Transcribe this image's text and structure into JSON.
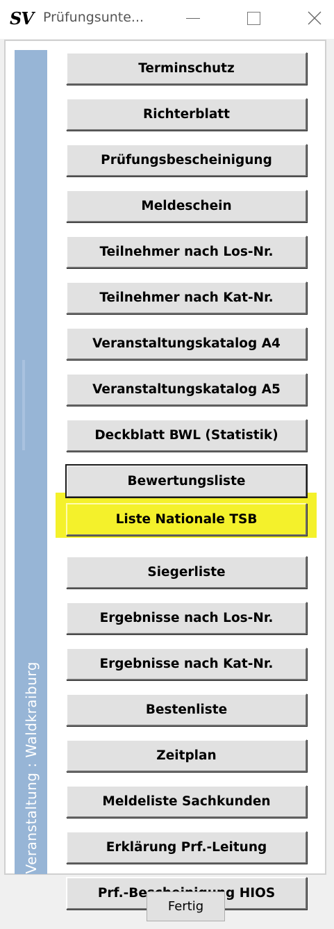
{
  "window": {
    "app_icon_text": "SV",
    "title": "Prüfungsunte..."
  },
  "sidebar": {
    "label": "Veranstaltung : Waldkraiburg",
    "color": "#97b5d6"
  },
  "buttons": [
    {
      "label": "Terminschutz"
    },
    {
      "label": "Richterblatt"
    },
    {
      "label": "Prüfungsbescheinigung"
    },
    {
      "label": "Meldeschein"
    },
    {
      "label": "Teilnehmer nach Los-Nr."
    },
    {
      "label": "Teilnehmer nach Kat-Nr."
    },
    {
      "label": "Veranstaltungskatalog A4"
    },
    {
      "label": "Veranstaltungskatalog A5"
    },
    {
      "label": "Deckblatt BWL (Statistik)"
    },
    {
      "label": "Bewertungsliste"
    },
    {
      "label": "Liste Nationale TSB"
    },
    {
      "label": "Siegerliste"
    },
    {
      "label": "Ergebnisse nach Los-Nr."
    },
    {
      "label": "Ergebnisse nach Kat-Nr."
    },
    {
      "label": "Bestenliste"
    },
    {
      "label": "Zeitplan"
    },
    {
      "label": "Meldeliste Sachkunden"
    },
    {
      "label": "Erklärung Prf.-Leitung"
    },
    {
      "label": "Prf.-Bescheinigung HIOS"
    }
  ],
  "highlight_color": "#f4f12b",
  "footer": {
    "done_label": "Fertig"
  }
}
